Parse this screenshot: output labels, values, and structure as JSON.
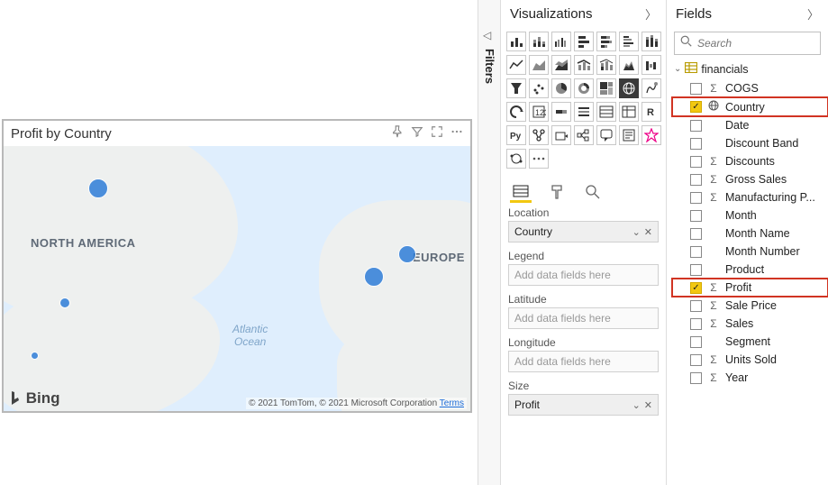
{
  "visual": {
    "title": "Profit by Country",
    "credit_prefix": "© 2021 TomTom, © 2021 Microsoft Corporation ",
    "credit_link": "Terms",
    "bing_label": "Bing",
    "labels": {
      "na": "NORTH AMERICA",
      "eu": "EUROPE",
      "atlantic_1": "Atlantic",
      "atlantic_2": "Ocean"
    }
  },
  "filters": {
    "label": "Filters"
  },
  "viz_panel": {
    "title": "Visualizations",
    "wells": {
      "location": {
        "label": "Location",
        "value": "Country"
      },
      "legend": {
        "label": "Legend",
        "placeholder": "Add data fields here"
      },
      "latitude": {
        "label": "Latitude",
        "placeholder": "Add data fields here"
      },
      "longitude": {
        "label": "Longitude",
        "placeholder": "Add data fields here"
      },
      "size": {
        "label": "Size",
        "value": "Profit"
      }
    }
  },
  "fields_panel": {
    "title": "Fields",
    "search_placeholder": "Search",
    "table": "financials",
    "fields": [
      {
        "name": "COGS",
        "icon": "Σ",
        "checked": false
      },
      {
        "name": "Country",
        "icon": "globe",
        "checked": true,
        "highlighted": true
      },
      {
        "name": "Date",
        "icon": "",
        "checked": false
      },
      {
        "name": "Discount Band",
        "icon": "",
        "checked": false
      },
      {
        "name": "Discounts",
        "icon": "Σ",
        "checked": false
      },
      {
        "name": "Gross Sales",
        "icon": "Σ",
        "checked": false
      },
      {
        "name": "Manufacturing P...",
        "icon": "Σ",
        "checked": false
      },
      {
        "name": "Month",
        "icon": "",
        "checked": false
      },
      {
        "name": "Month Name",
        "icon": "",
        "checked": false
      },
      {
        "name": "Month Number",
        "icon": "",
        "checked": false
      },
      {
        "name": "Product",
        "icon": "",
        "checked": false
      },
      {
        "name": "Profit",
        "icon": "Σ",
        "checked": true,
        "highlighted": true
      },
      {
        "name": "Sale Price",
        "icon": "Σ",
        "checked": false
      },
      {
        "name": "Sales",
        "icon": "Σ",
        "checked": false
      },
      {
        "name": "Segment",
        "icon": "",
        "checked": false
      },
      {
        "name": "Units Sold",
        "icon": "Σ",
        "checked": false
      },
      {
        "name": "Year",
        "icon": "Σ",
        "checked": false
      }
    ]
  }
}
